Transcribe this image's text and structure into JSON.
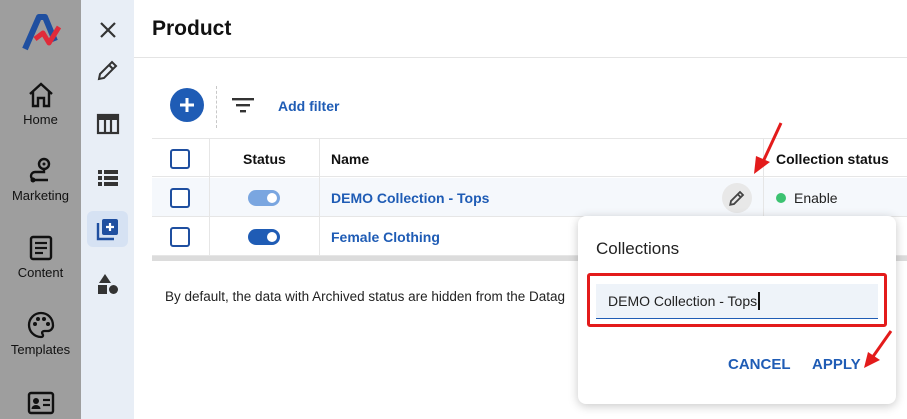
{
  "app": {
    "logo_icon": "app-logo-icon",
    "accent_color": "#1f5cb5"
  },
  "leftnav": {
    "items": [
      {
        "label": "Home",
        "icon": "home-icon"
      },
      {
        "label": "Marketing",
        "icon": "route-icon"
      },
      {
        "label": "Content",
        "icon": "document-icon"
      },
      {
        "label": "Templates",
        "icon": "palette-icon"
      },
      {
        "label": "",
        "icon": "id-card-icon"
      }
    ]
  },
  "rail": {
    "items": [
      {
        "icon": "close-icon"
      },
      {
        "icon": "pencil-icon"
      },
      {
        "icon": "table-icon"
      },
      {
        "icon": "list-icon"
      },
      {
        "icon": "add-collection-icon",
        "active": true
      },
      {
        "icon": "shapes-icon"
      }
    ]
  },
  "page": {
    "title": "Product"
  },
  "toolbar": {
    "add_filter_label": "Add filter"
  },
  "table": {
    "columns": {
      "status": "Status",
      "name": "Name",
      "collection_status": "Collection status"
    },
    "rows": [
      {
        "status_on": true,
        "name": "DEMO Collection - Tops",
        "collection_status": "Enable"
      },
      {
        "status_on": true,
        "name": "Female Clothing",
        "collection_status": ""
      }
    ]
  },
  "note": {
    "text": "By default, the data with Archived status are hidden from the Datag"
  },
  "popup": {
    "title": "Collections",
    "input_value": "DEMO Collection - Tops",
    "cancel_label": "CANCEL",
    "apply_label": "APPLY"
  },
  "colors": {
    "annotation_red": "#e31b1b",
    "status_green": "#3cc271"
  }
}
